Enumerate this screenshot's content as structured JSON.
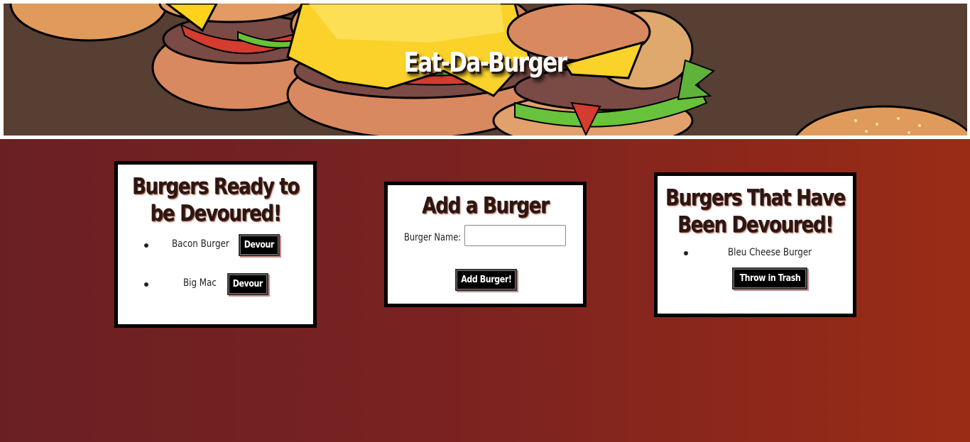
{
  "header": {
    "title": "Eat-Da-Burger"
  },
  "ready": {
    "title": "Burgers Ready to be Devoured!",
    "items": [
      {
        "name": "Bacon Burger",
        "button_label": "Devour"
      },
      {
        "name": "Big Mac",
        "button_label": "Devour"
      }
    ]
  },
  "add": {
    "title": "Add a Burger",
    "field_label": "Burger Name:",
    "field_value": "",
    "field_placeholder": "",
    "submit_label": "Add Burger!"
  },
  "devoured": {
    "title": "Burgers That Have Been Devoured!",
    "items": [
      {
        "name": "Bleu Cheese Burger",
        "button_label": "Throw in Trash"
      }
    ]
  },
  "colors": {
    "background_start": "#6a2023",
    "background_end": "#9a2c16",
    "header_bg": "#573f33",
    "button_bg": "#000000"
  }
}
